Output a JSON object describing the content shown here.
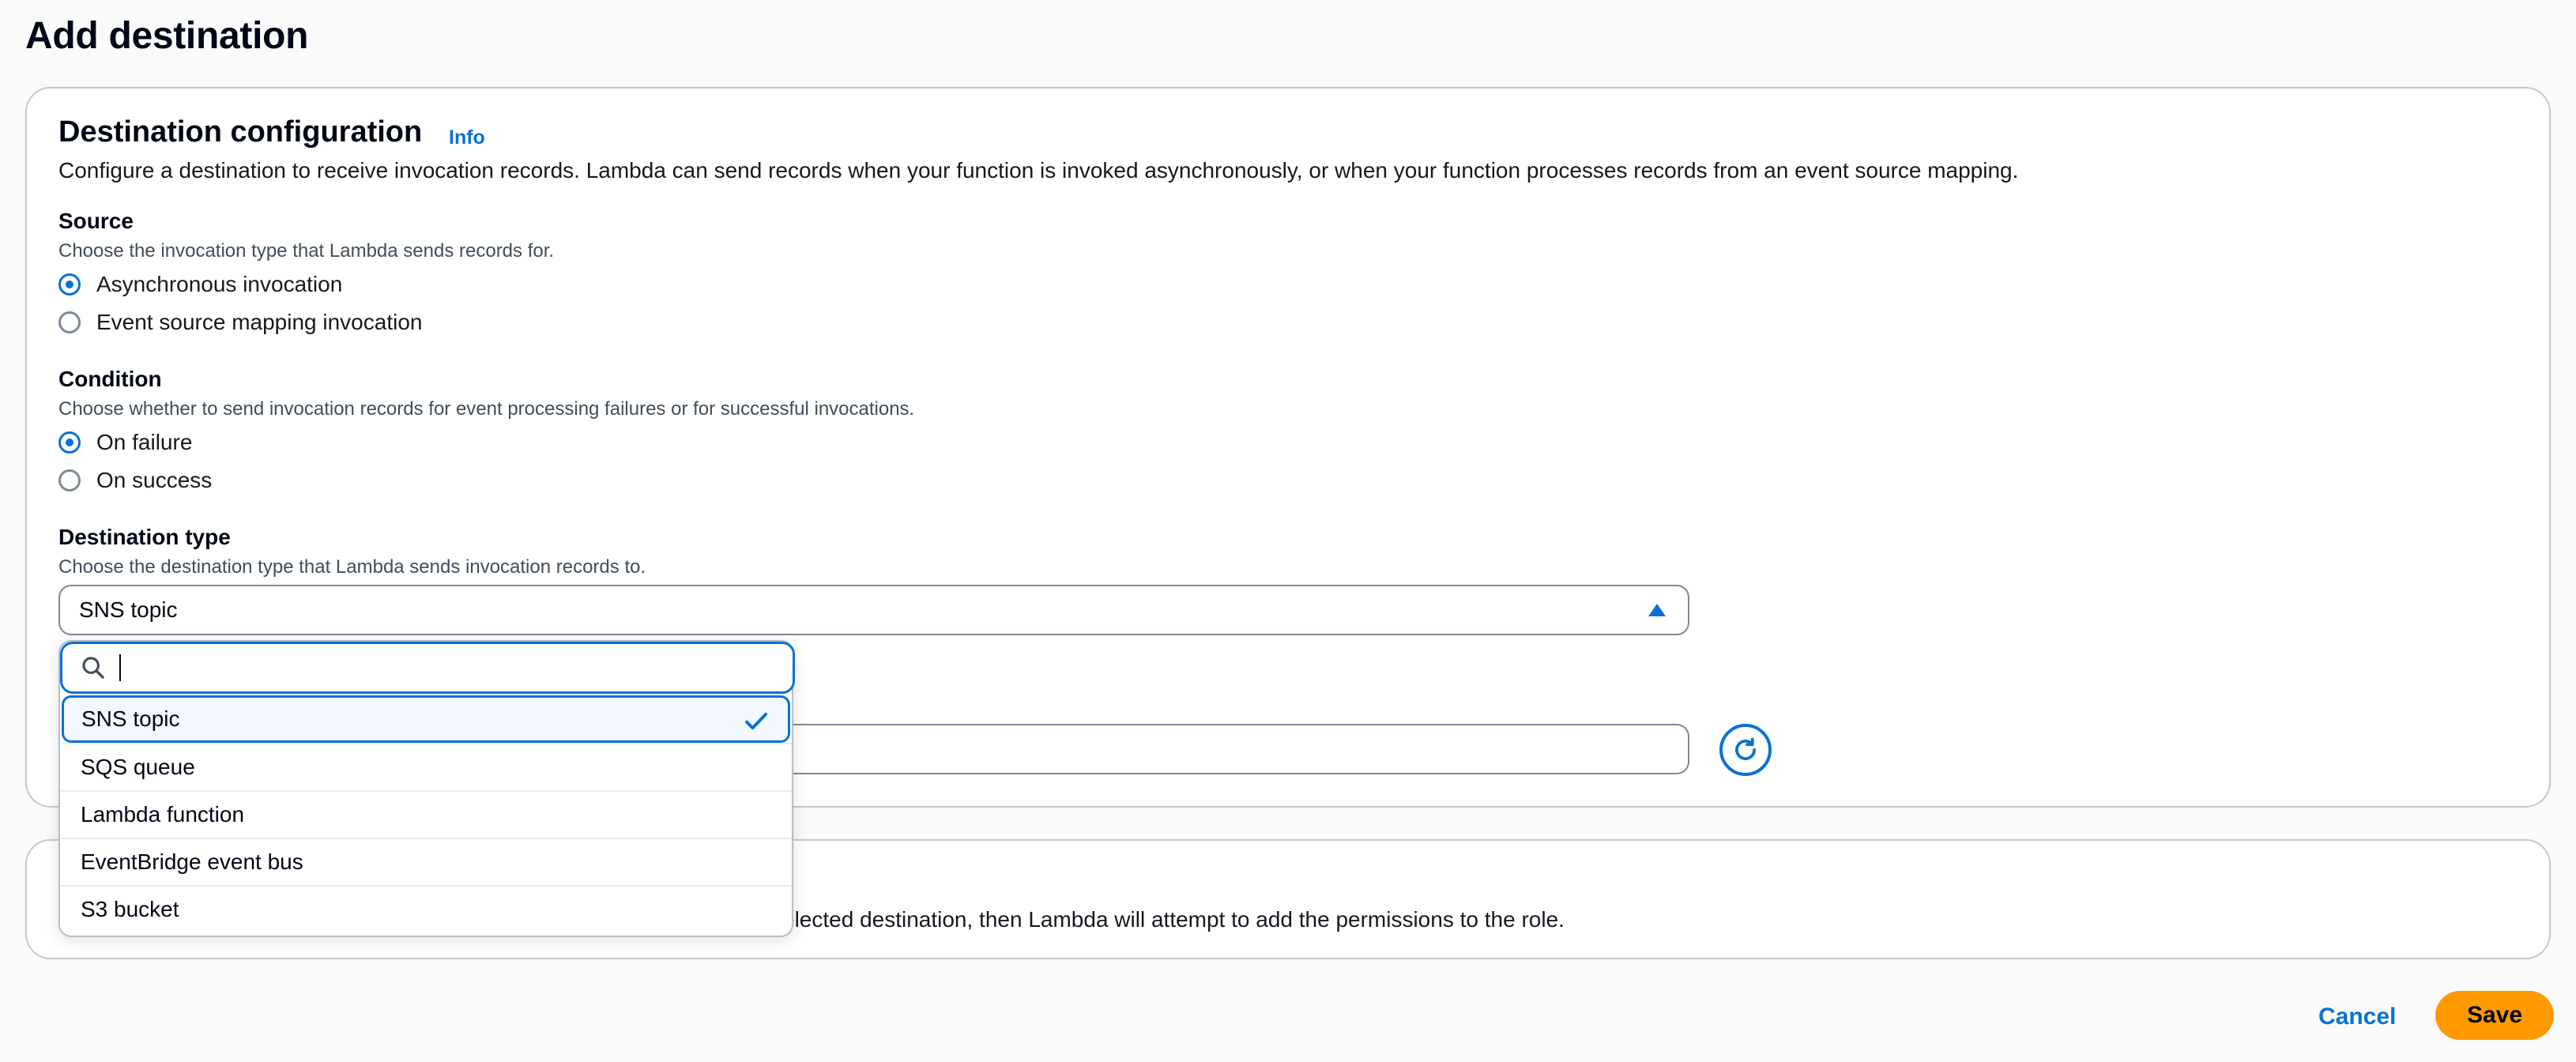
{
  "page": {
    "title": "Add destination"
  },
  "config": {
    "heading": "Destination configuration",
    "info": "Info",
    "description": "Configure a destination to receive invocation records. Lambda can send records when your function is invoked asynchronously, or when your function processes records from an event source mapping."
  },
  "source": {
    "label": "Source",
    "help": "Choose the invocation type that Lambda sends records for.",
    "options": [
      {
        "label": "Asynchronous invocation",
        "checked": true
      },
      {
        "label": "Event source mapping invocation",
        "checked": false
      }
    ]
  },
  "condition": {
    "label": "Condition",
    "help": "Choose whether to send invocation records for event processing failures or for successful invocations.",
    "options": [
      {
        "label": "On failure",
        "checked": true
      },
      {
        "label": "On success",
        "checked": false
      }
    ]
  },
  "destination_type": {
    "label": "Destination type",
    "help": "Choose the destination type that Lambda sends invocation records to.",
    "selected": "SNS topic",
    "search_value": "",
    "options": [
      {
        "label": "SNS topic",
        "selected": true
      },
      {
        "label": "SQS queue",
        "selected": false
      },
      {
        "label": "Lambda function",
        "selected": false
      },
      {
        "label": "EventBridge event bus",
        "selected": false
      },
      {
        "label": "S3 bucket",
        "selected": false
      }
    ]
  },
  "permissions": {
    "text_visible": "elected destination, then Lambda will attempt to add the permissions to the role."
  },
  "actions": {
    "cancel": "Cancel",
    "save": "Save"
  },
  "colors": {
    "accent": "#0972d3",
    "primary_button": "#ff9900"
  },
  "icons": {
    "search": "search-icon",
    "caret": "caret-up-icon",
    "check": "check-icon",
    "refresh": "refresh-icon"
  }
}
